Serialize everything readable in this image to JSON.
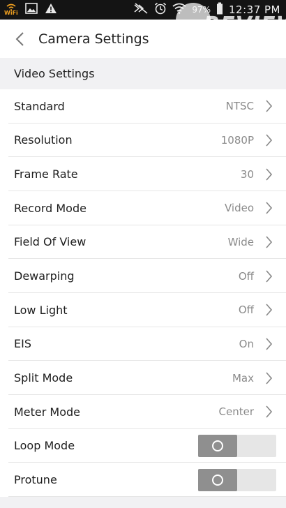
{
  "status_bar": {
    "wifi_label": "WiFi",
    "battery_percent": "97%",
    "time": "12:37 PM"
  },
  "watermark": {
    "text": "REVIEW"
  },
  "header": {
    "title": "Camera Settings"
  },
  "section": {
    "title": "Video Settings"
  },
  "settings": [
    {
      "label": "Standard",
      "value": "NTSC"
    },
    {
      "label": "Resolution",
      "value": "1080P"
    },
    {
      "label": "Frame Rate",
      "value": "30"
    },
    {
      "label": "Record Mode",
      "value": "Video"
    },
    {
      "label": "Field Of View",
      "value": "Wide"
    },
    {
      "label": "Dewarping",
      "value": "Off"
    },
    {
      "label": "Low Light",
      "value": "Off"
    },
    {
      "label": "EIS",
      "value": "On"
    },
    {
      "label": "Split Mode",
      "value": "Max"
    },
    {
      "label": "Meter Mode",
      "value": "Center"
    }
  ],
  "toggles": [
    {
      "label": "Loop Mode",
      "state": "off"
    },
    {
      "label": "Protune",
      "state": "off"
    }
  ],
  "colors": {
    "status_bar_bg": "#141414",
    "section_bg": "#f1f1f3",
    "toggle_knob": "#8f8f8f",
    "toggle_track": "#e6e6e6",
    "value_text": "#8a8a8a"
  }
}
